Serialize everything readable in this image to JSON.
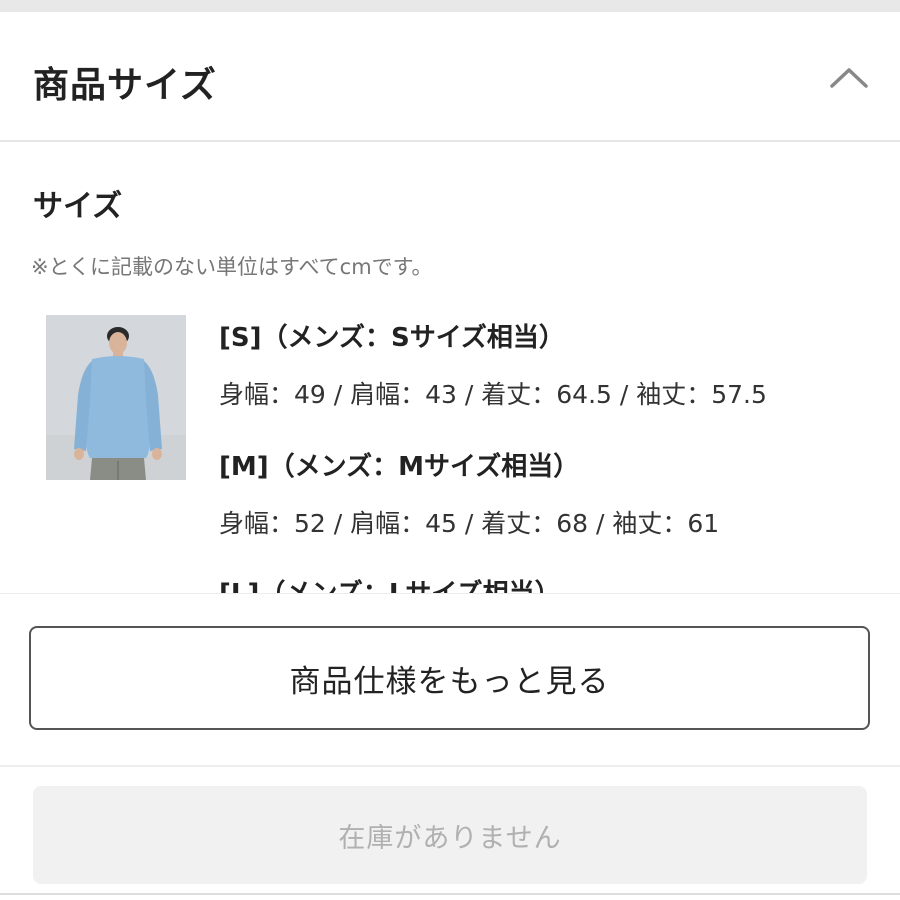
{
  "section": {
    "title": "商品サイズ",
    "collapse_icon": "chevron-up-icon"
  },
  "size_section": {
    "subtitle": "サイズ",
    "note": "※とくに記載のない単位はすべてcmです。",
    "image_icon": "product-photo-model-blue-shirt",
    "sizes": [
      {
        "label": "[S]（メンズ：Sサイズ相当）",
        "measurements": "身幅：49 / 肩幅：43 / 着丈：64.5 / 袖丈：57.5"
      },
      {
        "label": "[M]（メンズ：Mサイズ相当）",
        "measurements": "身幅：52 / 肩幅：45 / 着丈：68 / 袖丈：61"
      },
      {
        "label": "[L]（メンズ：Lサイズ相当）",
        "measurements": ""
      }
    ]
  },
  "buttons": {
    "more_specs": "商品仕様をもっと見る",
    "out_of_stock": "在庫がありません"
  },
  "colors": {
    "text": "#222222",
    "muted": "#777777",
    "disabled_bg": "#f1f1f1",
    "disabled_text": "#b0b0b0",
    "shirt": "#8fb9dd"
  }
}
